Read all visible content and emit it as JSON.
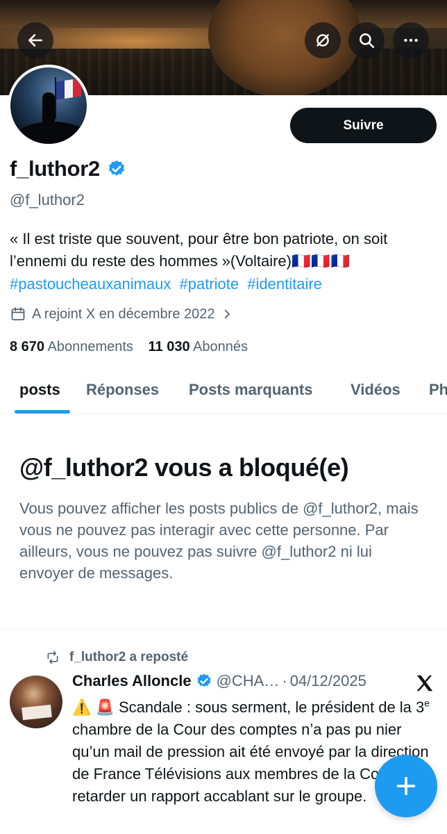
{
  "header": {
    "back_icon": "arrow-left-icon",
    "grok_icon": "grok-icon",
    "search_icon": "search-icon",
    "more_icon": "more-icon"
  },
  "profile": {
    "follow_label": "Suivre",
    "display_name": "f_luthor2",
    "handle": "@f_luthor2",
    "bio_text": "« Il est triste que souvent, pour être bon patriote, on soit l’ennemi du reste des hommes »(Voltaire)",
    "bio_flags": "🇫🇷🇫🇷🇫🇷",
    "hashtags": [
      "#pastoucheauxanimaux",
      "#patriote",
      "#identitaire"
    ],
    "joined": "A rejoint X en décembre 2022",
    "following_count": "8 670",
    "following_label": "Abonnements",
    "followers_count": "11 030",
    "followers_label": "Abonnés"
  },
  "tabs": [
    "posts",
    "Réponses",
    "Posts marquants",
    "Vidéos",
    "Photos"
  ],
  "blocked": {
    "title": "@f_luthor2 vous a bloqué(e)",
    "text": "Vous pouvez afficher les posts publics de @f_luthor2, mais vous ne pouvez pas interagir avec cette personne. Par ailleurs, vous ne pouvez pas suivre @f_luthor2 ni lui envoyer de messages."
  },
  "tweet": {
    "repost_label": "f_luthor2 a reposté",
    "author_name": "Charles Alloncle",
    "author_handle": "@CHA…",
    "separator": "·",
    "date": "04/12/2025",
    "body_prefix": "⚠️ 🚨 Scandale : sous serment, le président de la 3",
    "body_sup": "e",
    "body_rest": " chambre de la Cour des comptes n’a pas pu nier qu’un mail de pression ait été envoyé par la direction de France Télévisions aux membres de la Cour pour retarder un rapport accablant sur le groupe."
  },
  "colors": {
    "accent": "#1d9bf0",
    "text_primary": "#0f1419",
    "text_secondary": "#536471"
  }
}
